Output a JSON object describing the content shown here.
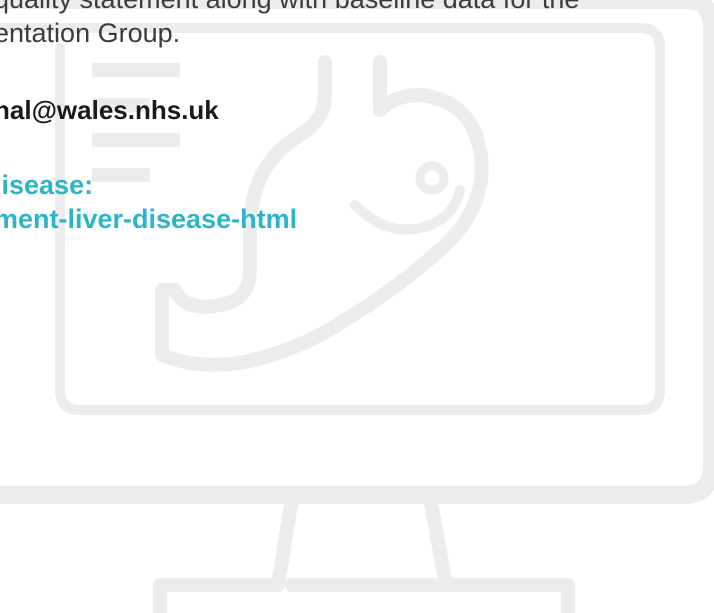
{
  "text": {
    "line1": "quality statement along with baseline data for the",
    "line2": "entation Group.",
    "email": "nal@wales.nhs.uk",
    "link_heading": "lisease:",
    "link_url": "ment-liver-disease-html"
  },
  "colors": {
    "body_text": "#3c3c3c",
    "email_text": "#1a1a1a",
    "link_accent": "#2cb5c9",
    "illustration_stroke": "#ececec"
  },
  "illustration": {
    "icons": [
      "computer-monitor-icon",
      "stomach-icon",
      "document-lines-icon"
    ]
  }
}
